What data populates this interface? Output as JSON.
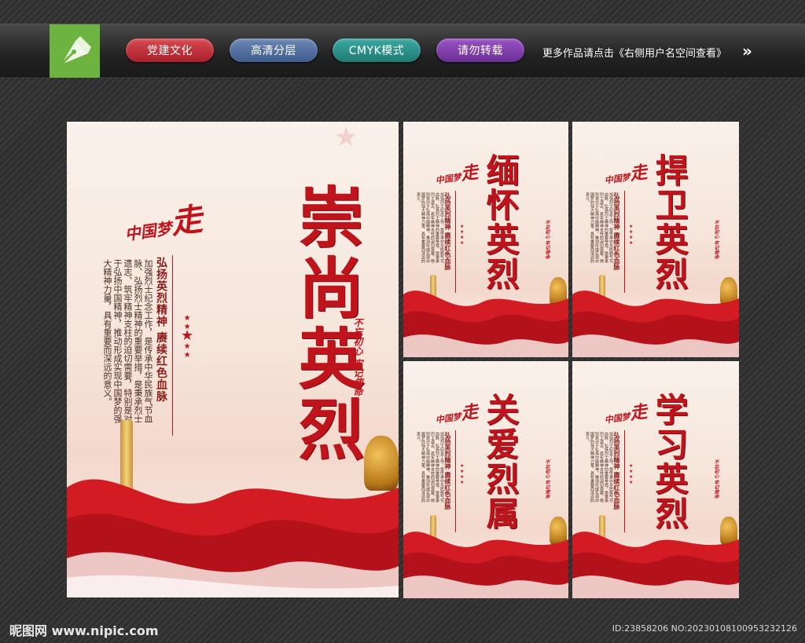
{
  "header": {
    "logo_icon": "pen-nib-logo-icon",
    "tags": [
      "党建文化",
      "高清分层",
      "CMYK模式",
      "请勿转载"
    ],
    "more_text": "更多作品请点击《右侧用户名空间查看》",
    "more_arrow": "»"
  },
  "colors": {
    "title_red": "#c0141d",
    "tag1": "#c0262f",
    "tag2": "#4f6ea0",
    "tag3": "#2a8f88",
    "tag4": "#7f3eab",
    "logo_green": "#6db33f"
  },
  "posters": [
    {
      "title": "崇尚英烈",
      "brand_prefix": "中国梦",
      "brand_mark": "走",
      "slogan": "弘扬英烈精神 赓续红色血脉",
      "body": "加强烈士纪念工作，是传承中华民族气节血脉、弘扬烈士精神的重要举措，是秉承烈士遗志、筑牢精神支柱的迫切需要，特别是对于弘扬中国精神，推动形成实现中国梦的强大精神力量，具有重要而深远的意义。",
      "seal": "不忘初心 牢记使命"
    },
    {
      "title": "缅怀英烈",
      "brand_prefix": "中国梦",
      "brand_mark": "走",
      "slogan": "弘扬英烈精神 赓续红色血脉",
      "body": "加强烈士纪念工作，是传承中华民族气节血脉、弘扬烈士精神的重要举措，是秉承烈士遗志、筑牢精神支柱的迫切需要，特别是对于弘扬中国精神，推动形成实现中国梦的强大精神力量，具有重要而深远的意义。",
      "seal": "不忘初心 牢记使命"
    },
    {
      "title": "捍卫英烈",
      "brand_prefix": "中国梦",
      "brand_mark": "走",
      "slogan": "弘扬英烈精神 赓续红色血脉",
      "body": "加强烈士纪念工作，是传承中华民族气节血脉、弘扬烈士精神的重要举措，是秉承烈士遗志、筑牢精神支柱的迫切需要，特别是对于弘扬中国精神，推动形成实现中国梦的强大精神力量，具有重要而深远的意义。",
      "seal": "不忘初心 牢记使命"
    },
    {
      "title": "关爱烈属",
      "brand_prefix": "中国梦",
      "brand_mark": "走",
      "slogan": "弘扬英烈精神 赓续红色血脉",
      "body": "加强烈士纪念工作，是传承中华民族气节血脉、弘扬烈士精神的重要举措，是秉承烈士遗志、筑牢精神支柱的迫切需要，特别是对于弘扬中国精神，推动形成实现中国梦的强大精神力量，具有重要而深远的意义。",
      "seal": "不忘初心 牢记使命"
    },
    {
      "title": "学习英烈",
      "brand_prefix": "中国梦",
      "brand_mark": "走",
      "slogan": "弘扬英烈精神 赓续红色血脉",
      "body": "加强烈士纪念工作，是传承中华民族气节血脉、弘扬烈士精神的重要举措，是秉承烈士遗志、筑牢精神支柱的迫切需要，特别是对于弘扬中国精神，推动形成实现中国梦的强大精神力量，具有重要而深远的意义。",
      "seal": "不忘初心 牢记使命"
    }
  ],
  "footer": {
    "site": "昵图网 www.nipic.com",
    "id_text": "ID:23858206 NO:20230108100953232126"
  }
}
